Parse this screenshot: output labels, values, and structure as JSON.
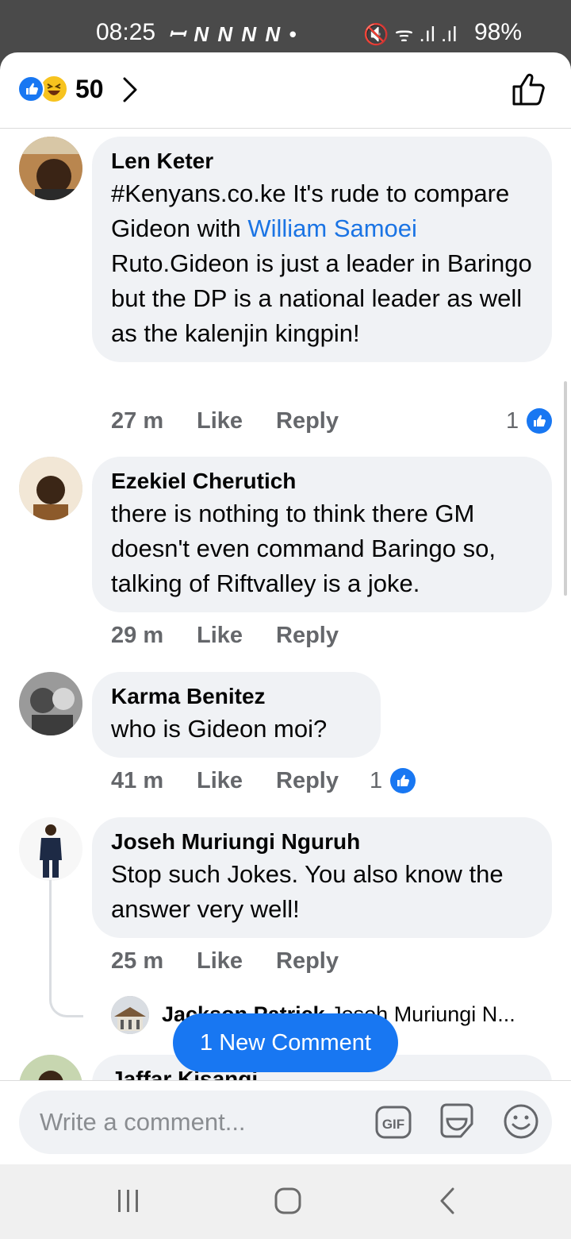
{
  "status_bar": {
    "time": "08:25",
    "notification_icons": "ꟷ N N N N •",
    "signal_icons": "🔇 ᯤ .ıl .ıl",
    "battery": "98%"
  },
  "reactions": {
    "count": "50",
    "types": [
      "like-icon",
      "haha-icon"
    ],
    "colors": {
      "like": "#1877f2",
      "haha": "#f7c31e"
    }
  },
  "comments": [
    {
      "author": "Len Keter",
      "text_before": "#Kenyans.co.ke It's rude to compare Gideon with ",
      "mention": "William Samoei",
      "text_after": " Ruto.Gideon is just a leader in Baringo but the DP is a national leader as well as the kalenjin kingpin!",
      "time": "27 m",
      "like_label": "Like",
      "reply_label": "Reply",
      "like_count": "1"
    },
    {
      "author": "Ezekiel Cherutich",
      "text": "there is nothing to think there GM doesn't even command Baringo so, talking of Riftvalley is a joke.",
      "time": "29 m",
      "like_label": "Like",
      "reply_label": "Reply"
    },
    {
      "author": "Karma Benitez",
      "text": "who is Gideon moi?",
      "time": "41 m",
      "like_label": "Like",
      "reply_label": "Reply",
      "like_count": "1"
    },
    {
      "author": "Joseh Muriungi Nguruh",
      "text": "Stop such Jokes. You also know the answer very well!",
      "time": "25 m",
      "like_label": "Like",
      "reply_label": "Reply"
    },
    {
      "author": "Jaffar Kisangi"
    }
  ],
  "reply_preview": {
    "author": "Jackson Patrick",
    "text": "Joseh Muriungi N..."
  },
  "new_comment_button": "1 New Comment",
  "composer": {
    "placeholder": "Write a comment...",
    "gif_label": "GIF"
  },
  "accent_color": "#1877f2"
}
